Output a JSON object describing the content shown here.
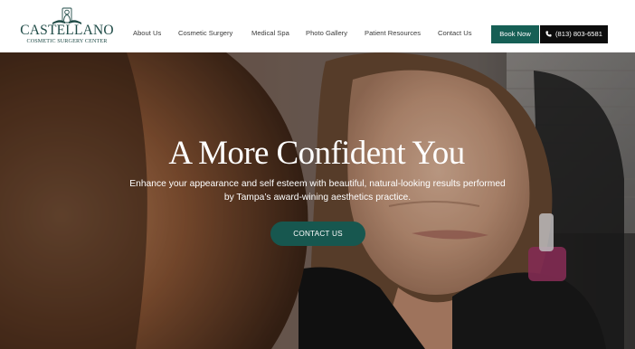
{
  "logo": {
    "name": "CASTELLANO",
    "tagline": "COSMETIC SURGERY CENTER",
    "emblem_icon": "sculpture-bust-icon"
  },
  "nav": {
    "items": [
      {
        "label": "About Us"
      },
      {
        "label": "Cosmetic Surgery"
      },
      {
        "label": "Medical Spa"
      },
      {
        "label": "Photo Gallery"
      },
      {
        "label": "Patient Resources"
      },
      {
        "label": "Contact Us"
      }
    ]
  },
  "actions": {
    "book_label": "Book Now",
    "phone_label": "(813) 803-6581",
    "phone_icon": "phone-icon"
  },
  "hero": {
    "heading": "A More Confident You",
    "subheading": "Enhance your appearance and self esteem with beautiful, natural-looking results performed by Tampa’s award-wining aesthetics practice.",
    "cta_label": "CONTACT US"
  },
  "colors": {
    "brand_green": "#165f55",
    "phone_bg": "#0d0d0d",
    "logo_text": "#1f4b47"
  }
}
